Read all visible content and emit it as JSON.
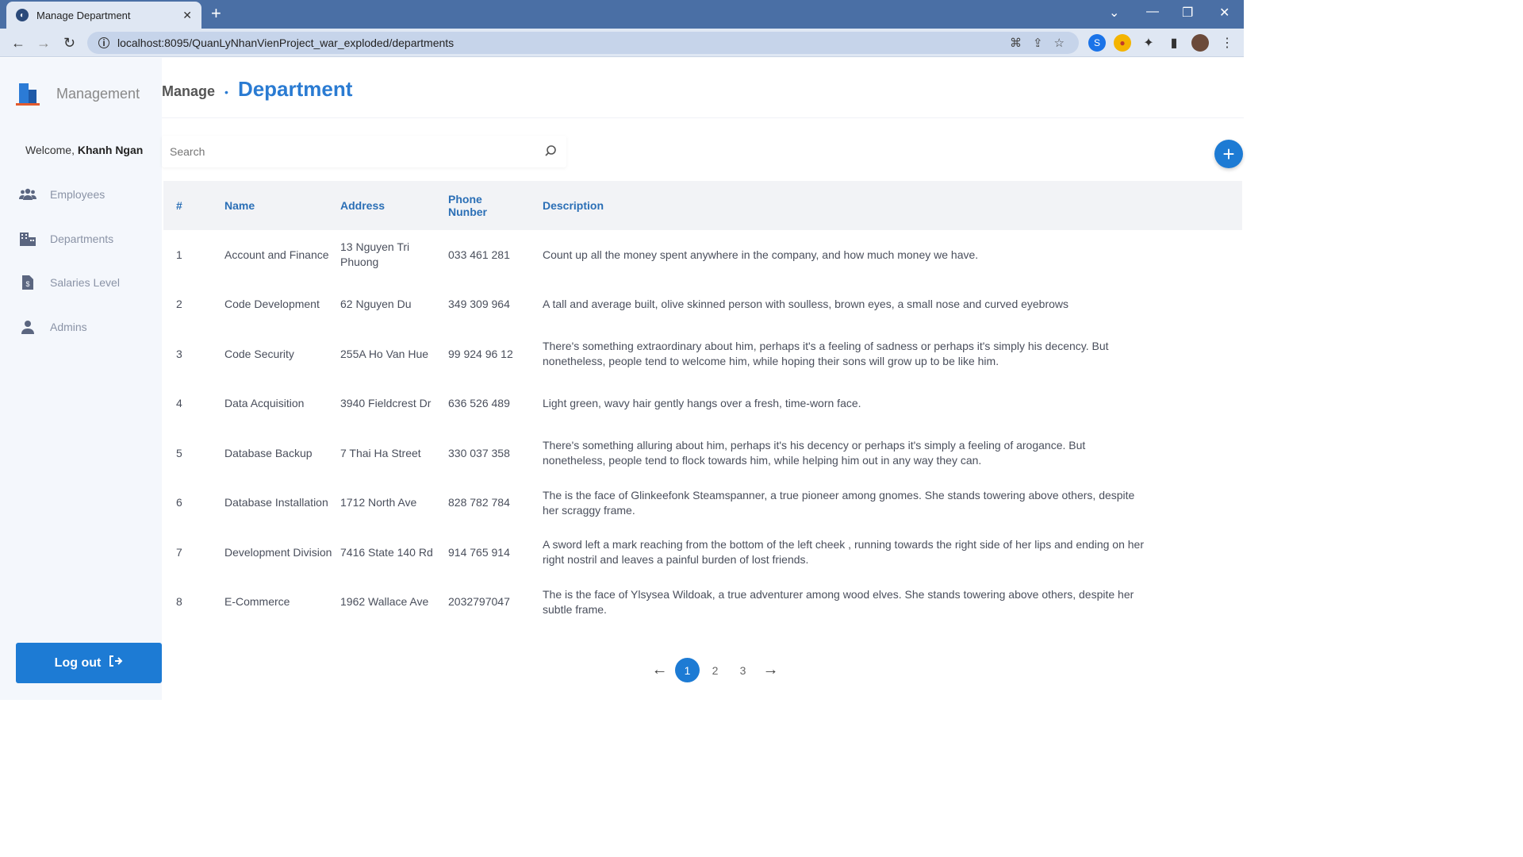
{
  "browser": {
    "tab_title": "Manage Department",
    "url": "localhost:8095/QuanLyNhanVienProject_war_exploded/departments"
  },
  "sidebar": {
    "brand": "Management",
    "welcome_prefix": "Welcome,",
    "username": "Khanh Ngan",
    "items": [
      {
        "label": "Employees",
        "icon": "users-icon"
      },
      {
        "label": "Departments",
        "icon": "building-icon"
      },
      {
        "label": "Salaries Level",
        "icon": "invoice-dollar-icon"
      },
      {
        "label": "Admins",
        "icon": "user-icon"
      }
    ],
    "logout_label": "Log out"
  },
  "header": {
    "crumb_parent": "Manage",
    "crumb_current": "Department"
  },
  "search": {
    "placeholder": "Search"
  },
  "table": {
    "headers": [
      "#",
      "Name",
      "Address",
      "Phone Nunber",
      "Description"
    ],
    "rows": [
      [
        "1",
        "Account and Finance",
        "13 Nguyen Tri Phuong",
        "033 461 281",
        "Count up all the money spent anywhere in the company, and how much money we have."
      ],
      [
        "2",
        "Code Development",
        "62 Nguyen Du",
        "349 309 964",
        "A tall and average built, olive skinned person with soulless, brown eyes, a small nose and curved eyebrows"
      ],
      [
        "3",
        "Code Security",
        "255A Ho Van Hue",
        "99 924 96 12",
        "There's something extraordinary about him, perhaps it's a feeling of sadness or perhaps it's simply his decency. But nonetheless, people tend to welcome him, while hoping their sons will grow up to be like him."
      ],
      [
        "4",
        "Data Acquisition",
        "3940 Fieldcrest Dr",
        "636 526 489",
        "Light green, wavy hair gently hangs over a fresh, time-worn face."
      ],
      [
        "5",
        "Database Backup",
        "7 Thai Ha Street",
        "330 037 358",
        "There's something alluring about him, perhaps it's his decency or perhaps it's simply a feeling of arogance. But nonetheless, people tend to flock towards him, while helping him out in any way they can."
      ],
      [
        "6",
        "Database Installation",
        "1712 North Ave",
        "828 782 784",
        "The is the face of Glinkeefonk Steamspanner, a true pioneer among gnomes. She stands towering above others, despite her scraggy frame."
      ],
      [
        "7",
        "Development Division",
        "7416 State 140 Rd",
        "914 765 914",
        "A sword left a mark reaching from the bottom of the left cheek , running towards the right side of her lips and ending on her right nostril and leaves a painful burden of lost friends."
      ],
      [
        "8",
        "E-Commerce",
        "1962 Wallace Ave",
        "2032797047",
        "The is the face of Ylsysea Wildoak, a true adventurer among wood elves. She stands towering above others, despite her subtle frame."
      ]
    ]
  },
  "pagination": {
    "pages": [
      "1",
      "2",
      "3"
    ],
    "current": "1"
  },
  "colors": {
    "accent": "#1d7bd4",
    "sidebar_bg": "#f4f7fc"
  }
}
